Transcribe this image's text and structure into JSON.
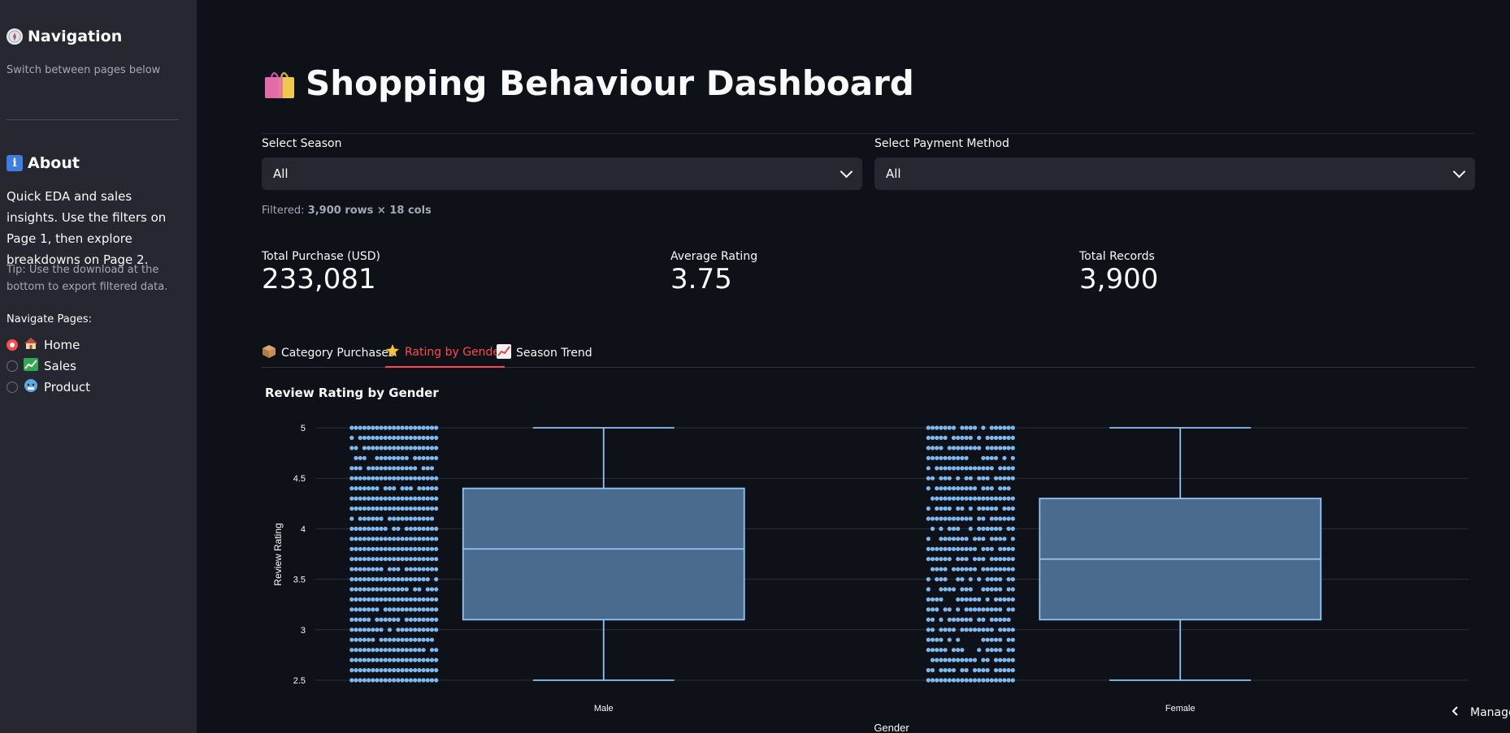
{
  "sidebar": {
    "nav_heading": "Navigation",
    "nav_sub": "Switch between pages below",
    "about_heading": "About",
    "about_text": "Quick EDA and sales insights. Use the filters on Page 1, then explore breakdowns on Page 2.",
    "tip": "Tip: Use the download at the bottom to export filtered data.",
    "navigate_label": "Navigate Pages:",
    "pages": [
      {
        "label": "Home",
        "icon": "house-icon",
        "selected": true
      },
      {
        "label": "Sales",
        "icon": "chart-increasing-icon",
        "selected": false
      },
      {
        "label": "Product",
        "icon": "face-icon",
        "selected": false
      }
    ]
  },
  "main": {
    "title": "Shopping Behaviour Dashboard",
    "title_icon": "shopping-bags-icon",
    "filters": {
      "season": {
        "label": "Select Season",
        "value": "All"
      },
      "payment": {
        "label": "Select Payment Method",
        "value": "All"
      }
    },
    "filtered_prefix": "Filtered: ",
    "filtered_value": "3,900 rows × 18 cols",
    "metrics": [
      {
        "label": "Total Purchase (USD)",
        "value": "233,081"
      },
      {
        "label": "Average Rating",
        "value": "3.75"
      },
      {
        "label": "Total Records",
        "value": "3,900"
      }
    ],
    "tabs": [
      {
        "label": "Category Purchases",
        "icon": "package-icon",
        "active": false
      },
      {
        "label": "Rating by Gender",
        "icon": "star-icon",
        "active": true
      },
      {
        "label": "Season Trend",
        "icon": "chart-increasing-icon",
        "active": false
      }
    ],
    "manage_label": "Manage"
  },
  "colors": {
    "accent": "#ff4b4b",
    "box_fill": "#4a6b8d",
    "box_stroke": "#8ec5f5",
    "points": "#7db8ee"
  },
  "chart_data": {
    "type": "box",
    "title": "Review Rating by Gender",
    "xlabel": "Gender",
    "ylabel": "Review Rating",
    "categories": [
      "Male",
      "Female"
    ],
    "y_ticks": [
      "2.5",
      "3",
      "3.5",
      "4",
      "4.5",
      "5"
    ],
    "ylim": [
      2.5,
      5
    ],
    "grid": true,
    "boxes": [
      {
        "name": "Male",
        "min": 2.5,
        "q1": 3.1,
        "median": 3.8,
        "q3": 4.4,
        "max": 5.0
      },
      {
        "name": "Female",
        "min": 2.5,
        "q1": 3.1,
        "median": 3.7,
        "q3": 4.3,
        "max": 5.0
      }
    ]
  }
}
